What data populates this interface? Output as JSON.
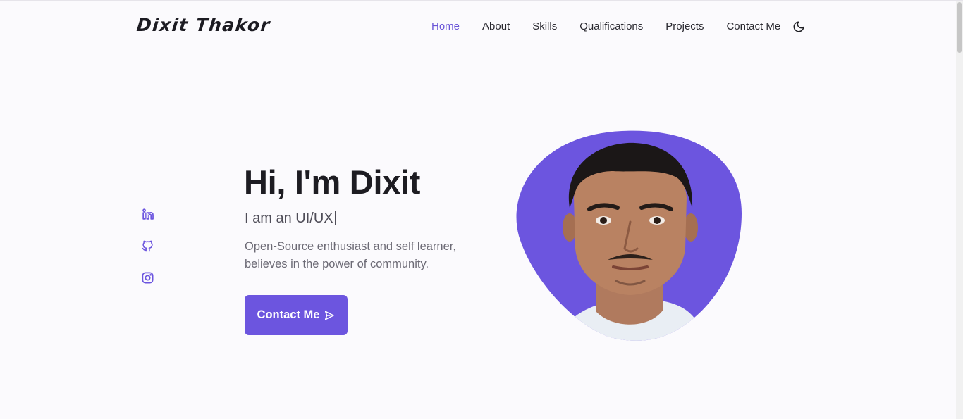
{
  "header": {
    "logo": "Dixit Thakor",
    "nav": [
      {
        "label": "Home",
        "active": true
      },
      {
        "label": "About",
        "active": false
      },
      {
        "label": "Skills",
        "active": false
      },
      {
        "label": "Qualifications",
        "active": false
      },
      {
        "label": "Projects",
        "active": false
      },
      {
        "label": "Contact Me",
        "active": false
      }
    ],
    "theme_icon": "moon-icon"
  },
  "socials": [
    {
      "icon": "linkedin-icon"
    },
    {
      "icon": "github-icon"
    },
    {
      "icon": "instagram-icon"
    }
  ],
  "hero": {
    "title": "Hi, I'm Dixit",
    "subtitle": "I am an UI/UX",
    "description": "Open-Source enthusiast and self learner, believes in the power of community.",
    "cta_label": "Contact Me",
    "cta_icon": "send-icon"
  },
  "colors": {
    "accent": "#6c55df",
    "background": "#fbfafd",
    "text": "#1d1c22"
  }
}
